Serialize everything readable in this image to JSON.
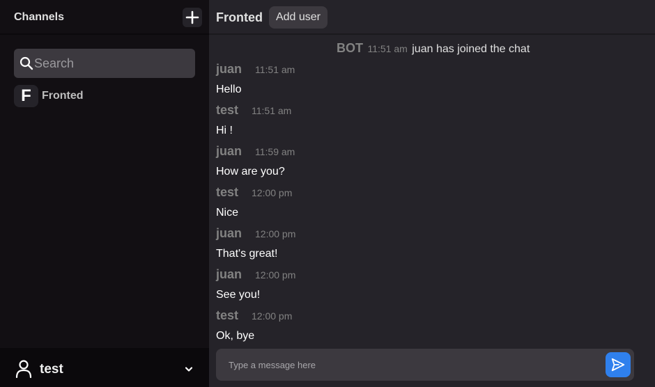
{
  "colors": {
    "sidebar_bg": "#120f13",
    "main_bg": "#252329",
    "input_bg": "#3c393f",
    "accent": "#2f80ed",
    "muted_text": "#828282"
  },
  "sidebar": {
    "title": "Channels",
    "add_icon": "plus-icon",
    "search": {
      "placeholder": "Search",
      "value": "",
      "icon": "search-icon"
    },
    "channels": [
      {
        "initial": "F",
        "name": "Fronted"
      }
    ],
    "user": {
      "name": "test",
      "icon": "user-icon",
      "menu_icon": "chevron-down-icon"
    }
  },
  "header": {
    "channel_title": "Fronted",
    "add_user_label": "Add user"
  },
  "bot_message": {
    "author": "BOT",
    "time": "11:51 am",
    "text": "juan has joined the chat"
  },
  "messages": [
    {
      "author": "juan",
      "time": "11:51 am",
      "text": "Hello"
    },
    {
      "author": "test",
      "time": "11:51 am",
      "text": "Hi !"
    },
    {
      "author": "juan",
      "time": "11:59 am",
      "text": "How are you?"
    },
    {
      "author": "test",
      "time": "12:00 pm",
      "text": "Nice"
    },
    {
      "author": "juan",
      "time": "12:00 pm",
      "text": "That's great!"
    },
    {
      "author": "juan",
      "time": "12:00 pm",
      "text": "See you!"
    },
    {
      "author": "test",
      "time": "12:00 pm",
      "text": "Ok, bye"
    }
  ],
  "composer": {
    "placeholder": "Type a message here",
    "value": "",
    "send_icon": "send-icon"
  }
}
